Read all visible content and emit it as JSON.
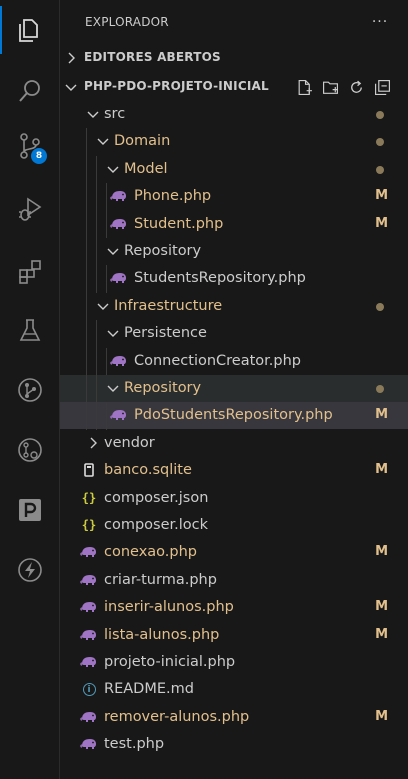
{
  "explorer": {
    "title": "EXPLORADOR",
    "more": "···"
  },
  "activity_bar": {
    "items": [
      {
        "name": "explorer-icon",
        "active": true
      },
      {
        "name": "search-icon"
      },
      {
        "name": "source-control-icon",
        "badge": "8"
      },
      {
        "name": "run-debug-icon"
      },
      {
        "name": "extensions-icon"
      },
      {
        "name": "testing-icon"
      },
      {
        "name": "git-graph-icon"
      },
      {
        "name": "pull-requests-icon"
      },
      {
        "name": "pocket-p-icon"
      },
      {
        "name": "thunder-icon"
      }
    ]
  },
  "open_editors": {
    "label": "EDITORES ABERTOS"
  },
  "project": {
    "label": "PHP-PDO-PROJETO-INICIAL",
    "actions": [
      "new-file-icon",
      "new-folder-icon",
      "refresh-icon",
      "collapse-all-icon"
    ]
  },
  "tree": [
    {
      "name": "src",
      "type": "folder",
      "open": true,
      "depth": 1,
      "dot": true
    },
    {
      "name": "Domain",
      "type": "folder",
      "open": true,
      "depth": 2,
      "dot": true,
      "mod": true
    },
    {
      "name": "Model",
      "type": "folder",
      "open": true,
      "depth": 3,
      "dot": true,
      "mod": true
    },
    {
      "name": "Phone.php",
      "type": "php",
      "depth": 4,
      "status": "M",
      "mod": true
    },
    {
      "name": "Student.php",
      "type": "php",
      "depth": 4,
      "status": "M",
      "mod": true
    },
    {
      "name": "Repository",
      "type": "folder",
      "open": true,
      "depth": 3
    },
    {
      "name": "StudentsRepository.php",
      "type": "php",
      "depth": 4
    },
    {
      "name": "Infraestructure",
      "type": "folder",
      "open": true,
      "depth": 2,
      "dot": true,
      "mod": true
    },
    {
      "name": "Persistence",
      "type": "folder",
      "open": true,
      "depth": 3
    },
    {
      "name": "ConnectionCreator.php",
      "type": "php",
      "depth": 4
    },
    {
      "name": "Repository",
      "type": "folder",
      "open": true,
      "depth": 3,
      "dot": true,
      "mod": true,
      "hover": true
    },
    {
      "name": "PdoStudentsRepository.php",
      "type": "php",
      "depth": 4,
      "status": "M",
      "mod": true,
      "selected": true
    },
    {
      "name": "vendor",
      "type": "folder",
      "open": false,
      "depth": 1
    },
    {
      "name": "banco.sqlite",
      "type": "db",
      "depth": 1,
      "status": "M",
      "mod": true
    },
    {
      "name": "composer.json",
      "type": "json",
      "depth": 1
    },
    {
      "name": "composer.lock",
      "type": "json",
      "depth": 1
    },
    {
      "name": "conexao.php",
      "type": "php",
      "depth": 1,
      "status": "M",
      "mod": true
    },
    {
      "name": "criar-turma.php",
      "type": "php",
      "depth": 1
    },
    {
      "name": "inserir-alunos.php",
      "type": "php",
      "depth": 1,
      "status": "M",
      "mod": true
    },
    {
      "name": "lista-alunos.php",
      "type": "php",
      "depth": 1,
      "status": "M",
      "mod": true
    },
    {
      "name": "projeto-inicial.php",
      "type": "php",
      "depth": 1
    },
    {
      "name": "README.md",
      "type": "info",
      "depth": 1
    },
    {
      "name": "remover-alunos.php",
      "type": "php",
      "depth": 1,
      "status": "M",
      "mod": true
    },
    {
      "name": "test.php",
      "type": "php",
      "depth": 1
    }
  ],
  "colors": {
    "modified": "#e2c08d",
    "php_icon": "#a074c4",
    "accent": "#0078d4",
    "background": "#181818",
    "selected_row": "#37373d"
  }
}
